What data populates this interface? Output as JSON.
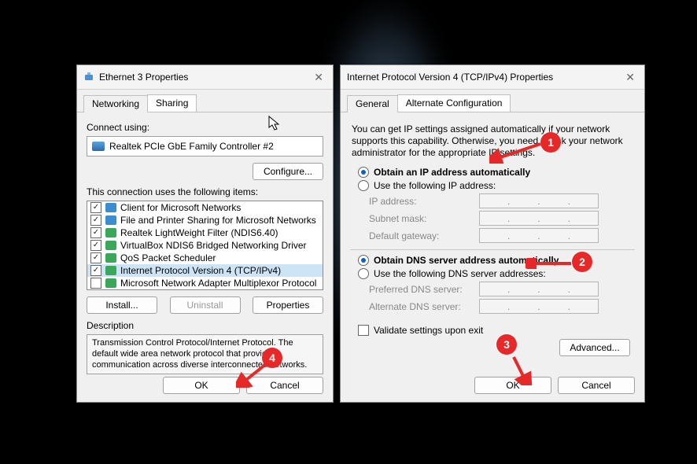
{
  "left": {
    "title": "Ethernet 3 Properties",
    "tabs": {
      "networking": "Networking",
      "sharing": "Sharing"
    },
    "connect_using_label": "Connect using:",
    "adapter_name": "Realtek PCIe GbE Family Controller #2",
    "configure_btn": "Configure...",
    "items_label": "This connection uses the following items:",
    "items": [
      {
        "label": "Client for Microsoft Networks",
        "checked": true,
        "icon": "blue"
      },
      {
        "label": "File and Printer Sharing for Microsoft Networks",
        "checked": true,
        "icon": "blue"
      },
      {
        "label": "Realtek LightWeight Filter (NDIS6.40)",
        "checked": true,
        "icon": "grn"
      },
      {
        "label": "VirtualBox NDIS6 Bridged Networking Driver",
        "checked": true,
        "icon": "grn"
      },
      {
        "label": "QoS Packet Scheduler",
        "checked": true,
        "icon": "grn"
      },
      {
        "label": "Internet Protocol Version 4 (TCP/IPv4)",
        "checked": true,
        "icon": "grn",
        "selected": true
      },
      {
        "label": "Microsoft Network Adapter Multiplexor Protocol",
        "checked": false,
        "icon": "grn"
      }
    ],
    "install_btn": "Install...",
    "uninstall_btn": "Uninstall",
    "properties_btn": "Properties",
    "description_label": "Description",
    "description_text": "Transmission Control Protocol/Internet Protocol. The default wide area network protocol that provides communication across diverse interconnected networks.",
    "ok": "OK",
    "cancel": "Cancel"
  },
  "right": {
    "title": "Internet Protocol Version 4 (TCP/IPv4) Properties",
    "tabs": {
      "general": "General",
      "alt": "Alternate Configuration"
    },
    "intro": "You can get IP settings assigned automatically if your network supports this capability. Otherwise, you need to ask your network administrator for the appropriate IP settings.",
    "radio_ip_auto": "Obtain an IP address automatically",
    "radio_ip_manual": "Use the following IP address:",
    "ip_address_label": "IP address:",
    "subnet_label": "Subnet mask:",
    "gateway_label": "Default gateway:",
    "radio_dns_auto": "Obtain DNS server address automatically",
    "radio_dns_manual": "Use the following DNS server addresses:",
    "pref_dns_label": "Preferred DNS server:",
    "alt_dns_label": "Alternate DNS server:",
    "validate_label": "Validate settings upon exit",
    "advanced_btn": "Advanced...",
    "ok": "OK",
    "cancel": "Cancel"
  },
  "annotations": {
    "a1": "1",
    "a2": "2",
    "a3": "3",
    "a4": "4"
  }
}
